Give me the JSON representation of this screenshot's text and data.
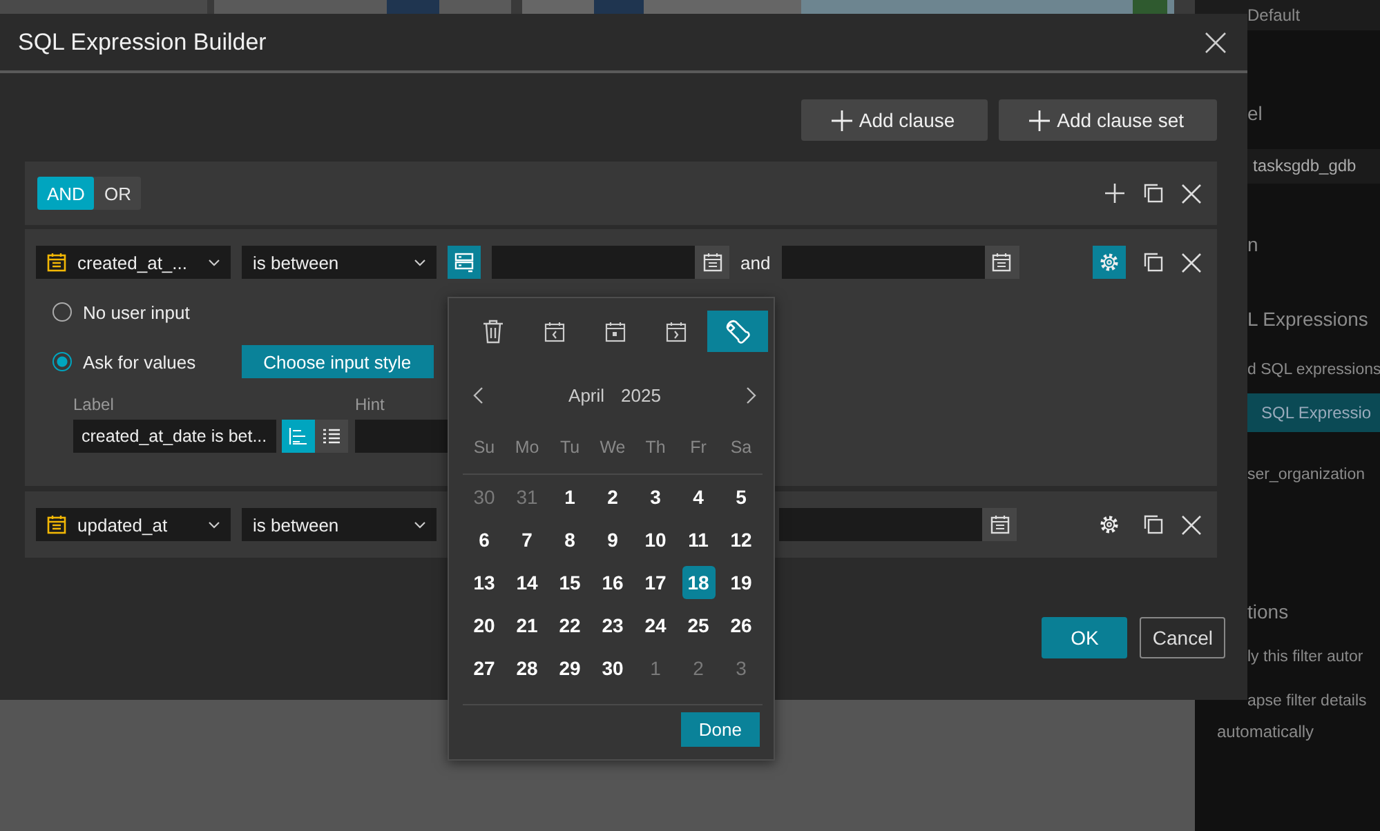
{
  "background": {
    "panel_items": [
      {
        "kind": "row",
        "text": "Default"
      },
      {
        "kind": "heading",
        "text": "el"
      },
      {
        "kind": "field",
        "text": "tasksgdb_gdb"
      },
      {
        "kind": "heading",
        "text": "n"
      },
      {
        "kind": "heading",
        "text": "L Expressions"
      },
      {
        "kind": "text",
        "text": "d SQL expressions"
      },
      {
        "kind": "active",
        "text": "SQL Expressio"
      },
      {
        "kind": "text",
        "text": "ser_organization"
      },
      {
        "kind": "heading",
        "text": "tions"
      },
      {
        "kind": "text",
        "text": "ly this filter autor"
      },
      {
        "kind": "text",
        "text": "apse filter details"
      },
      {
        "kind": "wrap",
        "text": "automatically"
      }
    ]
  },
  "dialog": {
    "title": "SQL Expression Builder",
    "actions": [
      {
        "label": "Add clause"
      },
      {
        "label": "Add clause set"
      }
    ],
    "logic": [
      {
        "label": "AND",
        "selected": true
      },
      {
        "label": "OR",
        "selected": false
      }
    ],
    "clauses": [
      {
        "field": "created_at_...",
        "operator": "is between",
        "source_toggle": {
          "selected": true
        },
        "range": [
          {
            "kind": "date-input"
          },
          {
            "kind": "text",
            "text": "and"
          },
          {
            "kind": "date-input"
          }
        ],
        "settings_active": true,
        "input_settings": {
          "radios": [
            {
              "label": "No user input",
              "selected": false
            },
            {
              "label": "Ask for values",
              "selected": true
            }
          ],
          "style_button": "Choose input style",
          "label_caption": "Label",
          "label_value": "created_at_date is bet...",
          "hint_caption": "Hint",
          "label_styles": [
            {
              "kind": "inline",
              "selected": true
            },
            {
              "kind": "list",
              "selected": false
            }
          ]
        }
      },
      {
        "field": "updated_at",
        "operator": "is between",
        "range": [
          {
            "kind": "date-input"
          }
        ],
        "settings_active": false
      }
    ],
    "buttons": [
      {
        "label": "OK",
        "kind": "primary"
      },
      {
        "label": "Cancel",
        "kind": "secondary"
      }
    ]
  },
  "date_picker": {
    "tools": [
      {
        "kind": "clear",
        "selected": false
      },
      {
        "kind": "previous",
        "selected": false
      },
      {
        "kind": "today",
        "selected": false
      },
      {
        "kind": "next",
        "selected": false
      },
      {
        "kind": "settings",
        "selected": true
      }
    ],
    "month": "April",
    "year": "2025",
    "weekdays": [
      "Su",
      "Mo",
      "Tu",
      "We",
      "Th",
      "Fr",
      "Sa"
    ],
    "weeks": [
      [
        {
          "day": "30",
          "in_month": false,
          "selected": false
        },
        {
          "day": "31",
          "in_month": false,
          "selected": false
        },
        {
          "day": "1",
          "in_month": true,
          "selected": false
        },
        {
          "day": "2",
          "in_month": true,
          "selected": false
        },
        {
          "day": "3",
          "in_month": true,
          "selected": false
        },
        {
          "day": "4",
          "in_month": true,
          "selected": false
        },
        {
          "day": "5",
          "in_month": true,
          "selected": false
        }
      ],
      [
        {
          "day": "6",
          "in_month": true,
          "selected": false
        },
        {
          "day": "7",
          "in_month": true,
          "selected": false
        },
        {
          "day": "8",
          "in_month": true,
          "selected": false
        },
        {
          "day": "9",
          "in_month": true,
          "selected": false
        },
        {
          "day": "10",
          "in_month": true,
          "selected": false
        },
        {
          "day": "11",
          "in_month": true,
          "selected": false
        },
        {
          "day": "12",
          "in_month": true,
          "selected": false
        }
      ],
      [
        {
          "day": "13",
          "in_month": true,
          "selected": false
        },
        {
          "day": "14",
          "in_month": true,
          "selected": false
        },
        {
          "day": "15",
          "in_month": true,
          "selected": false
        },
        {
          "day": "16",
          "in_month": true,
          "selected": false
        },
        {
          "day": "17",
          "in_month": true,
          "selected": false
        },
        {
          "day": "18",
          "in_month": true,
          "selected": true
        },
        {
          "day": "19",
          "in_month": true,
          "selected": false
        }
      ],
      [
        {
          "day": "20",
          "in_month": true,
          "selected": false
        },
        {
          "day": "21",
          "in_month": true,
          "selected": false
        },
        {
          "day": "22",
          "in_month": true,
          "selected": false
        },
        {
          "day": "23",
          "in_month": true,
          "selected": false
        },
        {
          "day": "24",
          "in_month": true,
          "selected": false
        },
        {
          "day": "25",
          "in_month": true,
          "selected": false
        },
        {
          "day": "26",
          "in_month": true,
          "selected": false
        }
      ],
      [
        {
          "day": "27",
          "in_month": true,
          "selected": false
        },
        {
          "day": "28",
          "in_month": true,
          "selected": false
        },
        {
          "day": "29",
          "in_month": true,
          "selected": false
        },
        {
          "day": "30",
          "in_month": true,
          "selected": false
        },
        {
          "day": "1",
          "in_month": false,
          "selected": false
        },
        {
          "day": "2",
          "in_month": false,
          "selected": false
        },
        {
          "day": "3",
          "in_month": false,
          "selected": false
        }
      ]
    ],
    "done": "Done"
  }
}
